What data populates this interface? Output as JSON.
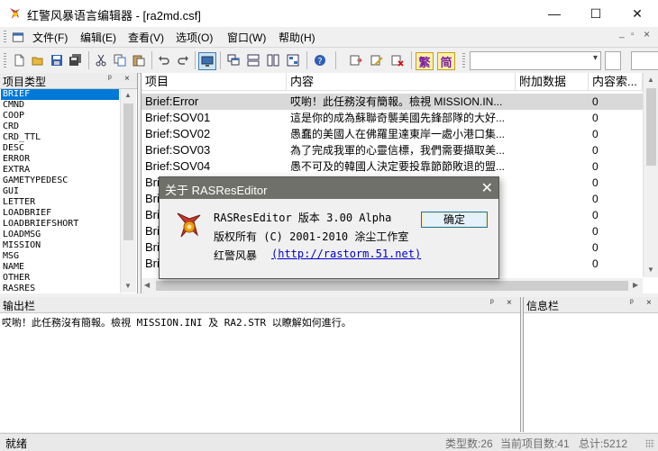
{
  "window": {
    "title": "红警风暴语言编辑器 - [ra2md.csf]",
    "minimize": "—",
    "maximize": "☐",
    "close": "✕"
  },
  "menu": {
    "items": [
      {
        "label": "文件(F)"
      },
      {
        "label": "编辑(E)"
      },
      {
        "label": "查看(V)"
      },
      {
        "label": "选项(O)"
      },
      {
        "label": "窗口(W)"
      },
      {
        "label": "帮助(H)"
      }
    ],
    "mdi_controls": [
      "_",
      "▫",
      "×"
    ]
  },
  "toolbar": {
    "buttons": [
      "new-doc",
      "open-folder",
      "save",
      "save-all",
      "cut",
      "copy",
      "paste",
      "undo",
      "redo",
      "screen",
      "cascade",
      "tile-horizontal",
      "tile-vertical",
      "arrange",
      "help",
      "export",
      "edit",
      "delete",
      "traditional",
      "simplified"
    ],
    "traditional_glyph": "繁",
    "simplified_glyph": "简"
  },
  "left_pane": {
    "title": "项目类型",
    "pin": "ᵖ",
    "close": "×",
    "items": [
      "BRIEF",
      "CMND",
      "COOP",
      "CRD",
      "CRD_TTL",
      "DESC",
      "ERROR",
      "EXTRA",
      "GAMETYPEDESC",
      "GUI",
      "LETTER",
      "LOADBRIEF",
      "LOADBRIEFSHORT",
      "LOADMSG",
      "MISSION",
      "MSG",
      "NAME",
      "OTHER",
      "RASRES"
    ],
    "selected": 0
  },
  "table": {
    "columns": [
      "项目",
      "内容",
      "附加数据",
      "内容索..."
    ],
    "rows": [
      {
        "item": "Brief:Error",
        "content": "哎喲！此任務沒有簡報。檢視 MISSION.IN...",
        "extra": "",
        "index": "0"
      },
      {
        "item": "Brief:SOV01",
        "content": "這是你的成為蘇聯奇襲美國先鋒部隊的大好...",
        "extra": "",
        "index": "0"
      },
      {
        "item": "Brief:SOV02",
        "content": "愚蠢的美國人在佛羅里達東岸一處小港口集...",
        "extra": "",
        "index": "0"
      },
      {
        "item": "Brief:SOV03",
        "content": "為了完成我軍的心靈信標，我們需要擷取美...",
        "extra": "",
        "index": "0"
      },
      {
        "item": "Brief:SOV04",
        "content": "愚不可及的韓國人決定要投靠節節敗退的盟...",
        "extra": "",
        "index": "0"
      },
      {
        "item": "Brief:",
        "content": "",
        "extra": "",
        "index": "0"
      },
      {
        "item": "Brief:",
        "content": "",
        "extra": "",
        "index": "0"
      },
      {
        "item": "Brief:",
        "content": "",
        "extra": "",
        "index": "0"
      },
      {
        "item": "Brief:",
        "content": "",
        "extra": "",
        "index": "0"
      },
      {
        "item": "Brief:",
        "content": "",
        "extra": "",
        "index": "0"
      },
      {
        "item": "Brief:",
        "content": "",
        "extra": "",
        "index": "0"
      }
    ]
  },
  "output_pane": {
    "title": "输出栏",
    "text": "哎喲！此任務沒有簡報。檢視 MISSION.INI 及 RA2.STR 以瞭解如何進行。"
  },
  "info_pane": {
    "title": "信息栏"
  },
  "status": {
    "ready": "就绪",
    "type_count": "类型数:26",
    "current_count": "当前项目数:41",
    "total": "总计:5212"
  },
  "dialog": {
    "title": "关于 RASResEditor",
    "close": "✕",
    "line1": "RASResEditor 版本 3.00 Alpha",
    "line2": "版权所有 (C) 2001-2010 涂尘工作室",
    "line3_label": "红警风暴",
    "link": "(http://rastorm.51.net)",
    "ok": "确定"
  },
  "colors": {
    "selection": "#0078d7",
    "dialog_title": "#70706a",
    "link": "#0000cc"
  }
}
